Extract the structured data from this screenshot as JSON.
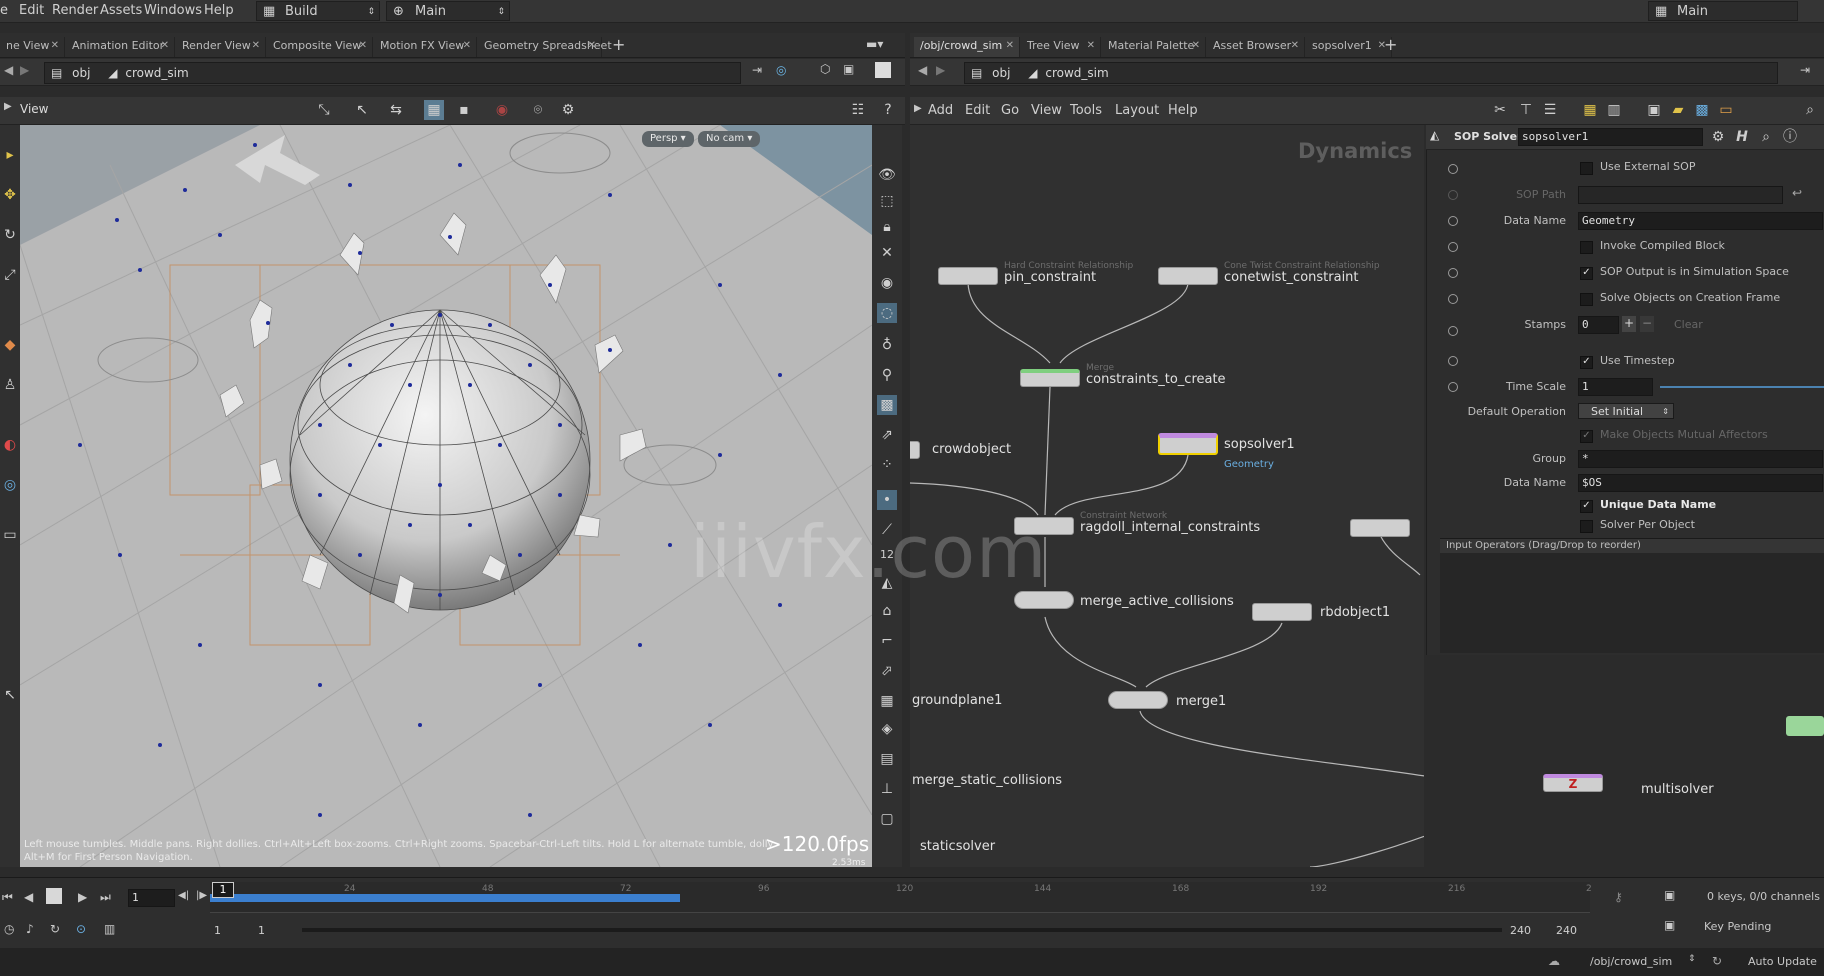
{
  "menubar": {
    "items": [
      "e",
      "Edit",
      "Render",
      "Assets",
      "Windows",
      "Help"
    ],
    "desktop": "Build",
    "context": "Main",
    "right_desktop": "Main"
  },
  "left_tabs": [
    "ne View",
    "Animation Editor",
    "Render View",
    "Composite View",
    "Motion FX View",
    "Geometry Spreadsheet"
  ],
  "right_tabs": [
    "/obj/crowd_sim",
    "Tree View",
    "Material Palette",
    "Asset Browser",
    "sopsolver1"
  ],
  "left_path": {
    "root": "obj",
    "node": "crowd_sim"
  },
  "right_path": {
    "root": "obj",
    "node": "crowd_sim"
  },
  "viewport": {
    "label": "View",
    "persp": "Persp",
    "cam": "No cam",
    "hint_line1": "Left mouse tumbles. Middle pans. Right dollies. Ctrl+Alt+Left box-zooms. Ctrl+Right zooms. Spacebar-Ctrl-Left tilts. Hold L for alternate tumble, dolly",
    "hint_line2": "Alt+M for First Person Navigation.",
    "fps": ">120.0fps",
    "ms": "2.53ms"
  },
  "network_menu": [
    "Add",
    "Edit",
    "Go",
    "View",
    "Tools",
    "Layout",
    "Help"
  ],
  "network": {
    "context_label": "Dynamics",
    "nodes": {
      "pin_constraint": {
        "label": "pin_constraint",
        "sub": "Hard Constraint Relationship"
      },
      "conetwist_constraint": {
        "label": "conetwist_constraint",
        "sub": "Cone Twist Constraint Relationship"
      },
      "constraints_to_create": {
        "label": "constraints_to_create",
        "sub": "Merge"
      },
      "crowdobject": {
        "label": "crowdobject"
      },
      "sopsolver1": {
        "label": "sopsolver1",
        "sub": "Geometry"
      },
      "ragdoll_internal_constraints": {
        "label": "ragdoll_internal_constraints",
        "sub": "Constraint Network"
      },
      "merge_active_collisions": {
        "label": "merge_active_collisions"
      },
      "rbdobject1": {
        "label": "rbdobject1"
      },
      "groundplane1": {
        "label": "groundplane1"
      },
      "merge1": {
        "label": "merge1"
      },
      "merge_static_collisions": {
        "label": "merge_static_collisions"
      },
      "multisolver": {
        "label": "multisolver"
      },
      "staticsolver": {
        "label": "staticsolver"
      }
    }
  },
  "params": {
    "type": "SOP Solver",
    "name": "sopsolver1",
    "use_external_sop": "Use External SOP",
    "sop_path_label": "SOP Path",
    "data_name_label": "Data Name",
    "data_name_value": "Geometry",
    "invoke_compiled_block": "Invoke Compiled Block",
    "sop_output_sim_space": "SOP Output is in Simulation Space",
    "solve_on_creation": "Solve Objects on Creation Frame",
    "stamps_label": "Stamps",
    "stamps_value": "0",
    "clear_label": "Clear",
    "use_timestep": "Use Timestep",
    "time_scale_label": "Time Scale",
    "time_scale_value": "1",
    "default_op_label": "Default Operation",
    "default_op_value": "Set Initial",
    "make_objects_mutual": "Make Objects Mutual Affectors",
    "group_label": "Group",
    "group_value": "*",
    "data_name2_label": "Data Name",
    "data_name2_value": "$OS",
    "unique_data_name": "Unique Data Name",
    "solver_per_object": "Solver Per Object",
    "input_operators": "Input Operators (Drag/Drop to reorder)"
  },
  "timeline": {
    "current_frame": "1",
    "marker": "1",
    "ticks": [
      "24",
      "48",
      "72",
      "96",
      "120",
      "144",
      "168",
      "192",
      "216",
      "2"
    ],
    "range_start": "1",
    "range_start2": "1",
    "range_end": "240",
    "range_end2": "240",
    "keys": "0 keys, 0/0 channels",
    "key_pending": "Key Pending",
    "status_path": "/obj/crowd_sim",
    "auto_update": "Auto Update"
  },
  "watermark": "iiivfx.com"
}
